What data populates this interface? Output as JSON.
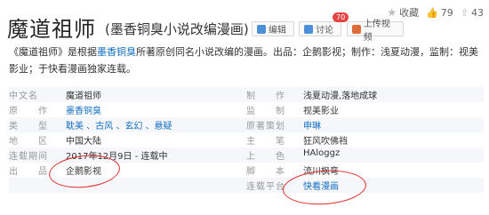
{
  "header": {
    "title": "魔道祖师",
    "subtitle": "(墨香铜臭小说改编漫画)",
    "edit_label": "编辑",
    "discuss_label": "讨论",
    "discuss_badge": "70",
    "upload_label": "上传视频"
  },
  "top_actions": {
    "favorite_label": "收藏",
    "like_count": "79",
    "share_count": "43"
  },
  "intro": {
    "part1": "《魔道祖师》是根据",
    "author_link": "墨香铜臭",
    "part2": "所著原创同名小说改编的漫画。出品：企鹅影视；制作：浅夏动漫，监制：视美影业；于快看漫画独家连载。"
  },
  "info": {
    "rows": [
      {
        "l_label": "中文名",
        "l_value": "魔道祖师",
        "r_label": "制　　作",
        "r_value": "浅夏动漫,落地成球"
      },
      {
        "l_label": "原　　作",
        "l_value": "墨香铜臭",
        "r_label": "监　　制",
        "r_value": "视美影业"
      },
      {
        "l_label": "类　　型",
        "l_value": "耽美 、古风 、玄幻 、悬疑",
        "r_label": "原著策划",
        "r_value": "申琳"
      },
      {
        "l_label": "地　　区",
        "l_value": "中国大陆",
        "r_label": "主　　笔",
        "r_value": "狂风吹佛裆"
      },
      {
        "l_label": "连载期间",
        "l_value": "2017年12月9日 - 连载中",
        "r_label": "上　　色",
        "r_value": "HAloggz"
      },
      {
        "l_label": "出　　品",
        "l_value": "企鹅影视",
        "r_label": "脚　　本",
        "r_value": "流川枫弯"
      },
      {
        "l_label": "",
        "l_value": "",
        "r_label": "连载平台",
        "r_value": "快看漫画"
      }
    ]
  },
  "colors": {
    "link": "#136ec2",
    "annotation": "#e02a2a",
    "badge": "#e64545"
  }
}
